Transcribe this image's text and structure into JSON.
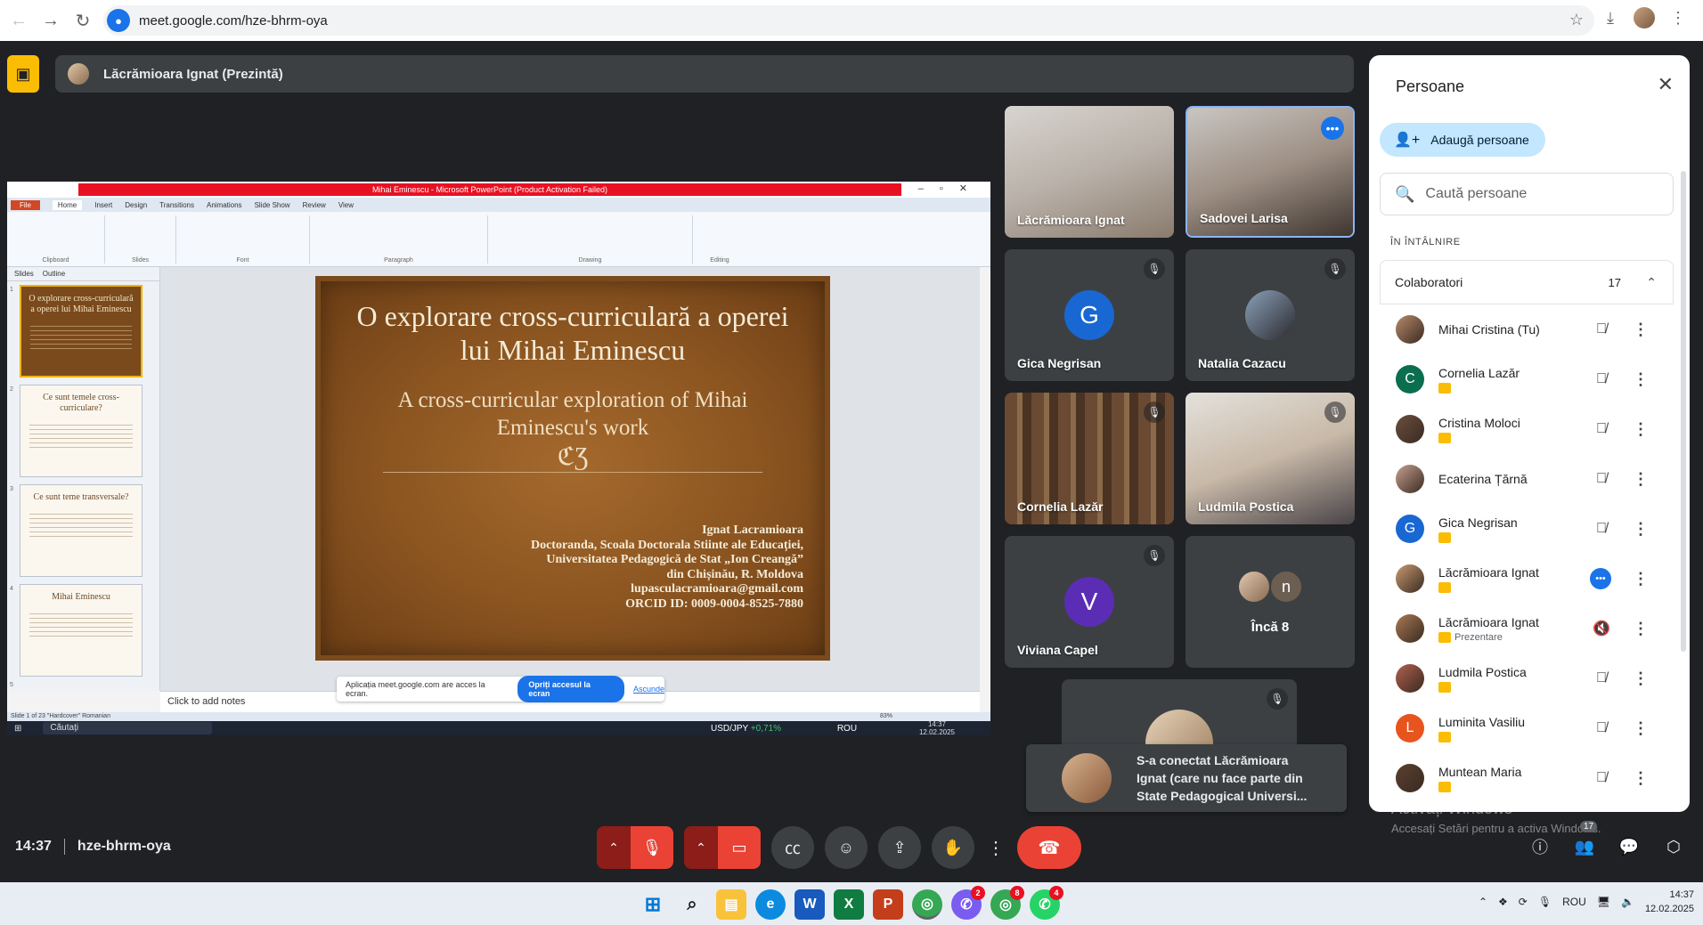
{
  "browser": {
    "url": "meet.google.com/hze-bhrm-oya"
  },
  "presenter_bar": {
    "label": "Lăcrămioara Ignat (Prezintă)"
  },
  "shared_screen": {
    "ppt_title": "Mihai Eminescu - Microsoft PowerPoint (Product Activation Failed)",
    "tabs": [
      "File",
      "Home",
      "Insert",
      "Design",
      "Transitions",
      "Animations",
      "Slide Show",
      "Review",
      "View"
    ],
    "ribbon_groups": [
      "Clipboard",
      "Slides",
      "Font",
      "Paragraph",
      "Drawing",
      "Editing"
    ],
    "pane_tabs": [
      "Slides",
      "Outline"
    ],
    "thumbnails": [
      {
        "num": "1",
        "title": "O explorare cross-curriculară a operei lui Mihai Eminescu"
      },
      {
        "num": "2",
        "title": "Ce sunt temele cross-curriculare?"
      },
      {
        "num": "3",
        "title": "Ce sunt teme transversale?"
      },
      {
        "num": "4",
        "title": "Mihai Eminescu"
      },
      {
        "num": "5",
        "title": ""
      }
    ],
    "slide": {
      "title": "O explorare cross-curriculară a operei lui Mihai Eminescu",
      "subtitle": "A cross-curricular exploration of Mihai Eminescu's work",
      "ornament": "ℭƷ",
      "author_lines": [
        "Ignat Lacramioara",
        "Doctoranda, Scoala Doctorala Stiinte ale Educației,",
        "Universitatea Pedagogică de Stat „Ion Creangă”",
        "din Chișinău, R. Moldova",
        "lupasculacramioara@gmail.com",
        "ORCID ID: 0009-0004-8525-7880"
      ]
    },
    "notes_placeholder": "Click to add notes",
    "share_banner": {
      "text": "Aplicația meet.google.com are acces la ecran.",
      "stop": "Opriți accesul la ecran",
      "hide": "Ascunde"
    },
    "status": "Slide 1 of 23   \"Hardcover\"   Romanian",
    "zoom": "83%",
    "taskbar_search": "Căutați",
    "ticker_pair": "USD/JPY",
    "ticker_change": "+0,71%",
    "lang": "ROU",
    "time": "14:37",
    "date": "12.02.2025"
  },
  "tiles": [
    {
      "name": "Lăcrămioara Ignat",
      "type": "camera"
    },
    {
      "name": "Sadovei Larisa",
      "type": "camera-active"
    },
    {
      "name": "Gica Negrisan",
      "type": "letter",
      "letter": "G",
      "color": "#1967d2"
    },
    {
      "name": "Natalia Cazacu",
      "type": "photo"
    },
    {
      "name": "Cornelia Lazăr",
      "type": "camera"
    },
    {
      "name": "Ludmila Postica",
      "type": "camera"
    },
    {
      "name": "Viviana Capel",
      "type": "letter",
      "letter": "V",
      "color": "#5b2db5"
    },
    {
      "name": "Încă 8",
      "type": "more",
      "letter": "n"
    }
  ],
  "toast": {
    "text": "S-a conectat Lăcrămioara Ignat (care nu face parte din State Pedagogical Universi..."
  },
  "meeting": {
    "time": "14:37",
    "code": "hze-bhrm-oya"
  },
  "people_panel": {
    "title": "Persoane",
    "add_label": "Adaugă persoane",
    "search_placeholder": "Caută persoane",
    "section": "ÎN ÎNTÂLNIRE",
    "group_label": "Colaboratori",
    "group_count": "17",
    "people": [
      {
        "name": "Mihai Cristina (Tu)",
        "avatar": "photo",
        "color": "#b88a6a"
      },
      {
        "name": "Cornelia Lazăr",
        "avatar": "letter",
        "letter": "C",
        "color": "#0b6e4f",
        "tag": true
      },
      {
        "name": "Cristina Moloci",
        "avatar": "photo",
        "color": "#6a4f3f",
        "tag": true
      },
      {
        "name": "Ecaterina Țărnă",
        "avatar": "photo",
        "color": "#c7a090"
      },
      {
        "name": "Gica Negrisan",
        "avatar": "letter",
        "letter": "G",
        "color": "#1967d2",
        "tag": true
      },
      {
        "name": "Lăcrămioara Ignat",
        "avatar": "photo",
        "color": "#c89a72",
        "tag": true,
        "speaking": true
      },
      {
        "name": "Lăcrămioara Ignat",
        "avatar": "photo",
        "color": "#a87a55",
        "tag": true,
        "tag_text": "Prezentare"
      },
      {
        "name": "Ludmila Postica",
        "avatar": "photo",
        "color": "#b06050",
        "tag": true
      },
      {
        "name": "Luminita Vasiliu",
        "avatar": "letter",
        "letter": "L",
        "color": "#e8541e",
        "tag": true
      },
      {
        "name": "Muntean Maria",
        "avatar": "photo",
        "color": "#5a4030",
        "tag": true
      }
    ]
  },
  "activation": {
    "line1": "Activați Windows",
    "line2": "Accesați Setări pentru a activa Windows."
  },
  "people_badge": "17",
  "taskbar": {
    "lang": "ROU",
    "time": "14:37",
    "date": "12.02.2025",
    "badges": [
      "2",
      "8",
      "4"
    ]
  }
}
